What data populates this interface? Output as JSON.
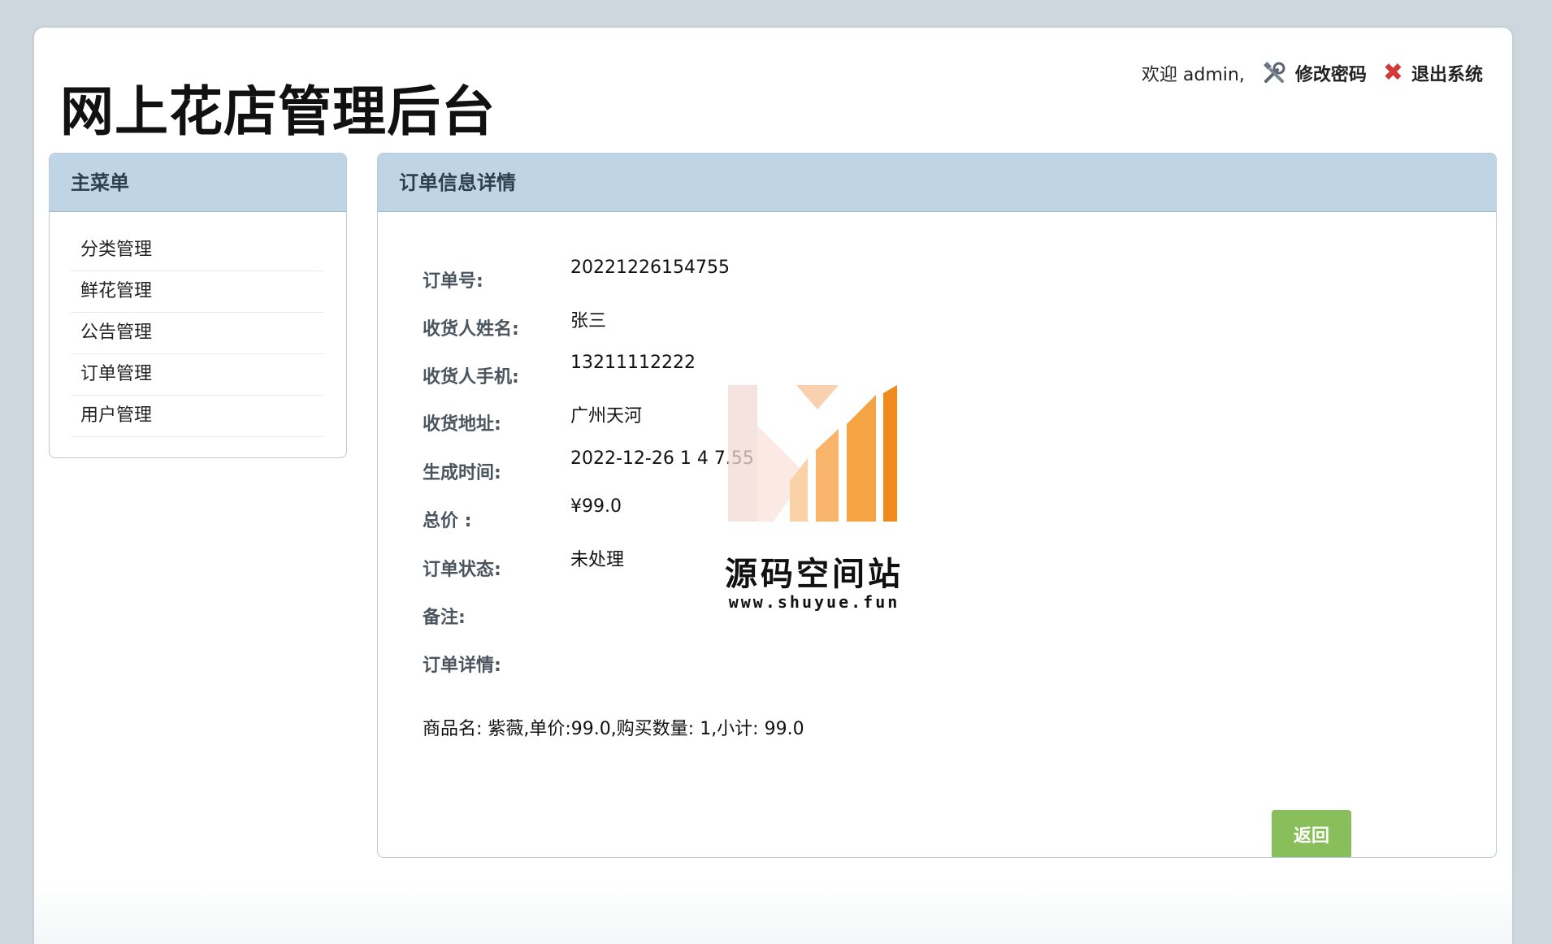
{
  "header": {
    "site_title": "网上花店管理后台",
    "welcome_text": "欢迎 admin,",
    "change_password_label": "修改密码",
    "logout_label": "退出系统",
    "change_password_icon": "tools-icon",
    "logout_icon": "close-icon"
  },
  "sidebar": {
    "title": "主菜单",
    "items": [
      {
        "label": "分类管理"
      },
      {
        "label": "鲜花管理"
      },
      {
        "label": "公告管理"
      },
      {
        "label": "订单管理"
      },
      {
        "label": "用户管理"
      }
    ]
  },
  "detail": {
    "title": "订单信息详情",
    "fields": [
      {
        "label": "订单号:",
        "value": "20221226154755"
      },
      {
        "label": "收货人姓名:",
        "value": "张三"
      },
      {
        "label": "收货人手机:",
        "value": "13211112222"
      },
      {
        "label": "收货地址:",
        "value": "广州天河"
      },
      {
        "label": "生成时间:",
        "value": "2022-12-26 1 4 7.55"
      },
      {
        "label": "总价 :",
        "value": "¥99.0"
      },
      {
        "label": "订单状态:",
        "value": "未处理"
      },
      {
        "label": "备注:",
        "value": ""
      },
      {
        "label": "订单详情:",
        "value": ""
      }
    ],
    "items_line": "商品名: 紫薇,单价:99.0,购买数量: 1,小计: 99.0",
    "back_label": "返回"
  },
  "watermark": {
    "text": "源码空间站",
    "url": "www.shuyue.fun"
  },
  "colors": {
    "panel_header": "#bfd5e5",
    "back_button": "#88bf5a",
    "logout_icon": "#d23a3a",
    "watermark_orange": "#f08a1c"
  }
}
